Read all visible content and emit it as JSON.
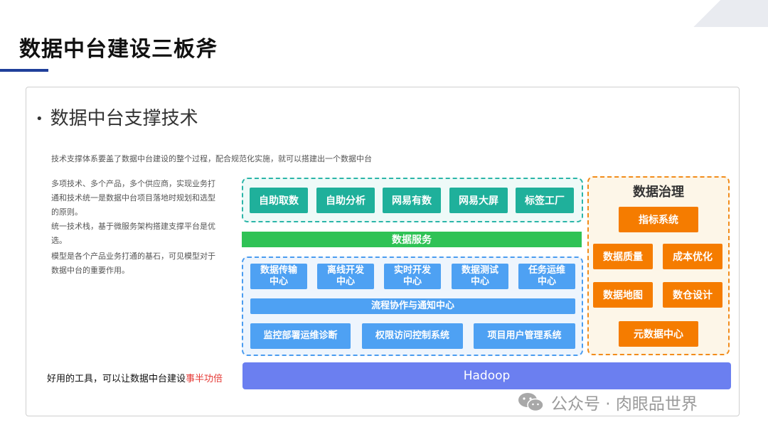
{
  "header": {
    "title": "数据中台建设三板斧"
  },
  "section": {
    "heading": "数据中台支撑技术",
    "bullet": "•"
  },
  "intro": "技术支撑体系要盖了数据中台建设的整个过程，配合规范化实施，就可以搭建出一个数据中台",
  "side_paragraphs": [
    "多项技术、多个产品，多个供应商，实现业务打通和技术统一是数据中台项目落地时规划和选型的原则。",
    "统一技术栈，基于微服务架构搭建支撑平台是优选。",
    "模型是各个产品业务打通的基石，可见模型对于数据中台的重要作用。"
  ],
  "bottom_note": {
    "text": "好用的工具，可以让数据中台建设",
    "highlight": "事半功倍",
    "highlight_color": "#e53935"
  },
  "top_tools": [
    "自助取数",
    "自助分析",
    "网易有数",
    "网易大屏",
    "标签工厂"
  ],
  "data_service": "数据服务",
  "dev_centers": [
    {
      "line1": "数据传输",
      "line2": "中心"
    },
    {
      "line1": "离线开发",
      "line2": "中心"
    },
    {
      "line1": "实时开发",
      "line2": "中心"
    },
    {
      "line1": "数据测试",
      "line2": "中心"
    },
    {
      "line1": "任务运维",
      "line2": "中心"
    }
  ],
  "flow_center": "流程协作与通知中心",
  "bottom_systems": [
    "监控部署运维诊断",
    "权限访问控制系统",
    "项目用户管理系统"
  ],
  "governance": {
    "title": "数据治理",
    "items": [
      "指标系统",
      "数据质量",
      "成本优化",
      "数据地图",
      "数仓设计",
      "元数据中心"
    ]
  },
  "hadoop": "Hadoop",
  "watermark": {
    "text": "公众号 · 肉眼品世界",
    "icon": "wechat-icon"
  },
  "colors": {
    "teal": "#1fb09b",
    "green": "#2fc255",
    "blue": "#4ea1f3",
    "orange": "#f57c00",
    "hadoop": "#6b7ff0",
    "accent_bar": "#1f3f9a"
  }
}
